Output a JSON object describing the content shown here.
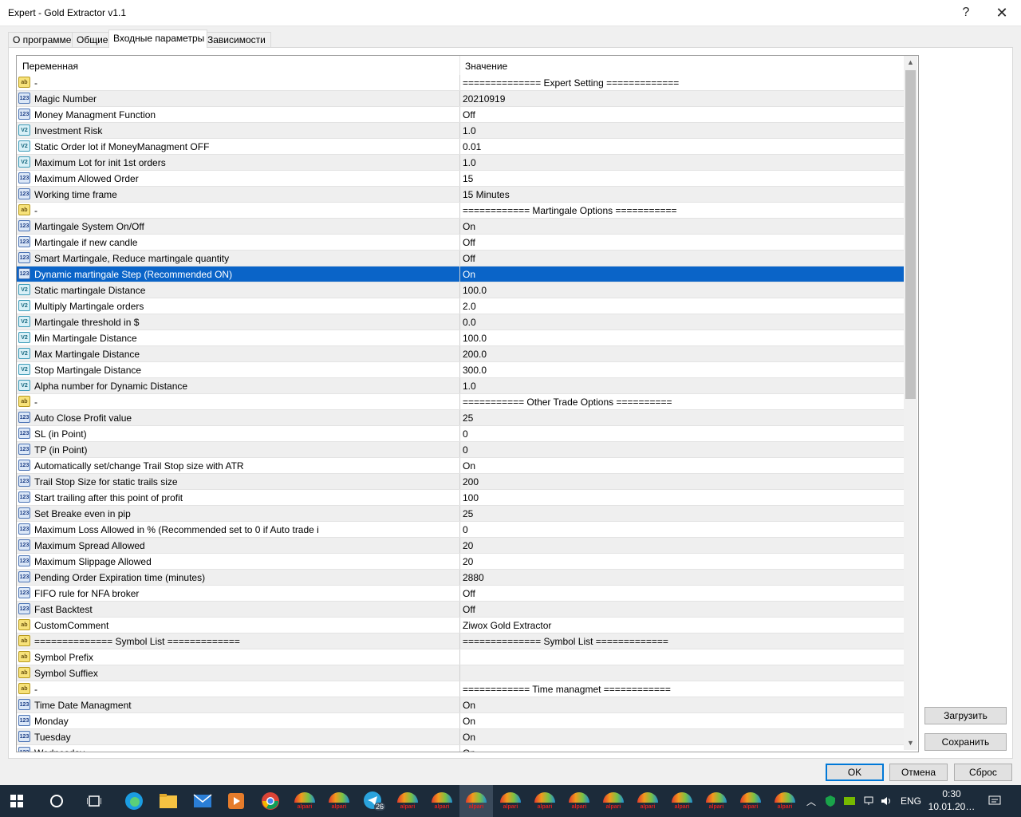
{
  "window": {
    "title": "Expert - Gold Extractor v1.1",
    "help_glyph": "?",
    "close_glyph": "✕"
  },
  "tabs": [
    {
      "label": "О программе"
    },
    {
      "label": "Общие"
    },
    {
      "label": "Входные параметры"
    },
    {
      "label": "Зависимости"
    }
  ],
  "grid": {
    "col_variable": "Переменная",
    "col_value": "Значение",
    "selected_row_index": 12,
    "rows": [
      {
        "type": "ab",
        "name": "-",
        "value": "============== Expert Setting ============="
      },
      {
        "type": "123",
        "name": "Magic Number",
        "value": "20210919"
      },
      {
        "type": "123",
        "name": "Money Managment Function",
        "value": "Off"
      },
      {
        "type": "v2",
        "name": "Investment Risk",
        "value": "1.0"
      },
      {
        "type": "v2",
        "name": "Static Order lot if MoneyManagment OFF",
        "value": "0.01"
      },
      {
        "type": "v2",
        "name": "Maximum Lot for init 1st orders",
        "value": "1.0"
      },
      {
        "type": "123",
        "name": "Maximum Allowed Order",
        "value": "15"
      },
      {
        "type": "123",
        "name": "Working time frame",
        "value": "15 Minutes"
      },
      {
        "type": "ab",
        "name": "-",
        "value": "============ Martingale Options ==========="
      },
      {
        "type": "123",
        "name": "Martingale System On/Off",
        "value": "On"
      },
      {
        "type": "123",
        "name": "Martingale if new candle",
        "value": "Off"
      },
      {
        "type": "123",
        "name": "Smart Martingale, Reduce martingale quantity",
        "value": "Off"
      },
      {
        "type": "123",
        "name": "Dynamic martingale Step (Recommended ON)",
        "value": "On"
      },
      {
        "type": "v2",
        "name": "Static martingale Distance",
        "value": "100.0"
      },
      {
        "type": "v2",
        "name": "Multiply Martingale orders",
        "value": "2.0"
      },
      {
        "type": "v2",
        "name": "Martingale threshold in $",
        "value": "0.0"
      },
      {
        "type": "v2",
        "name": "Min Martingale Distance",
        "value": "100.0"
      },
      {
        "type": "v2",
        "name": "Max Martingale Distance",
        "value": "200.0"
      },
      {
        "type": "v2",
        "name": "Stop Martingale Distance",
        "value": "300.0"
      },
      {
        "type": "v2",
        "name": "Alpha number for Dynamic Distance",
        "value": "1.0"
      },
      {
        "type": "ab",
        "name": "-",
        "value": "=========== Other Trade Options =========="
      },
      {
        "type": "123",
        "name": "Auto Close Profit value",
        "value": "25"
      },
      {
        "type": "123",
        "name": "SL (in Point)",
        "value": "0"
      },
      {
        "type": "123",
        "name": "TP (in Point)",
        "value": "0"
      },
      {
        "type": "123",
        "name": "Automatically set/change Trail Stop size with ATR",
        "value": "On"
      },
      {
        "type": "123",
        "name": "Trail Stop Size for static trails size",
        "value": "200"
      },
      {
        "type": "123",
        "name": "Start trailing after this point of profit",
        "value": "100"
      },
      {
        "type": "123",
        "name": "Set Breake even in pip",
        "value": "25"
      },
      {
        "type": "123",
        "name": "Maximum Loss Allowed in % (Recommended set to 0 if Auto trade i",
        "value": "0"
      },
      {
        "type": "123",
        "name": "Maximum Spread Allowed",
        "value": "20"
      },
      {
        "type": "123",
        "name": "Maximum Slippage Allowed",
        "value": "20"
      },
      {
        "type": "123",
        "name": "Pending Order Expiration time (minutes)",
        "value": "2880"
      },
      {
        "type": "123",
        "name": "FIFO rule for NFA broker",
        "value": "Off"
      },
      {
        "type": "123",
        "name": "Fast Backtest",
        "value": "Off"
      },
      {
        "type": "ab",
        "name": "CustomComment",
        "value": "Ziwox Gold Extractor"
      },
      {
        "type": "ab",
        "name": "============== Symbol List =============",
        "value": "============== Symbol List ============="
      },
      {
        "type": "ab",
        "name": "Symbol Prefix",
        "value": ""
      },
      {
        "type": "ab",
        "name": "Symbol Suffiex",
        "value": ""
      },
      {
        "type": "ab",
        "name": "-",
        "value": "============ Time managmet ============"
      },
      {
        "type": "123",
        "name": "Time Date Managment",
        "value": "On"
      },
      {
        "type": "123",
        "name": "Monday",
        "value": "On"
      },
      {
        "type": "123",
        "name": "Tuesday",
        "value": "On"
      },
      {
        "type": "123",
        "name": "Wednesday",
        "value": "On"
      }
    ]
  },
  "side_buttons": {
    "load": "Загрузить",
    "save": "Сохранить"
  },
  "dialog_buttons": {
    "ok": "OK",
    "cancel": "Отмена",
    "reset": "Сброс"
  },
  "taskbar": {
    "alpari_label": "alpari",
    "telegram_badge": "26",
    "lang": "ENG",
    "time": "0:30",
    "date": "10.01.20…"
  }
}
